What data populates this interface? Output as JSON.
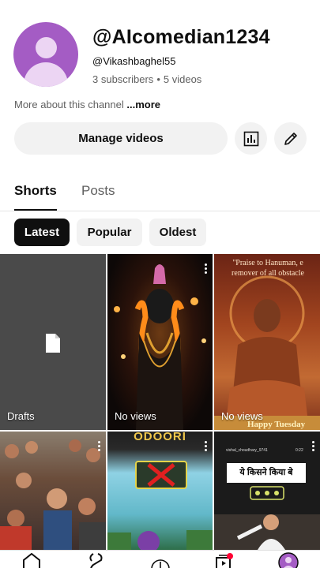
{
  "channel": {
    "name": "@AIcomedian1234",
    "handle": "@Vikashbaghel55",
    "subscribers": "3 subscribers",
    "separator": "•",
    "videos": "5 videos",
    "avatar_color": "#a45cc4"
  },
  "about": {
    "text": "More about this channel ",
    "more_label": "...more"
  },
  "actions": {
    "manage_label": "Manage videos",
    "stats_icon": "analytics-icon",
    "edit_icon": "pencil-icon"
  },
  "tabs": [
    {
      "label": "Shorts",
      "active": true
    },
    {
      "label": "Posts",
      "active": false
    }
  ],
  "filters": [
    {
      "label": "Latest",
      "active": true
    },
    {
      "label": "Popular",
      "active": false
    },
    {
      "label": "Oldest",
      "active": false
    }
  ],
  "shorts": [
    {
      "label": "Drafts",
      "icon": "document-icon"
    },
    {
      "label": "No views",
      "thumbnail_text": ""
    },
    {
      "label": "No views",
      "thumbnail_text": "\"Praise to Hanuman,  e remover of all obstacle",
      "bottom_text": "Happy Tuesday"
    },
    {
      "label": ""
    },
    {
      "label": "",
      "thumbnail_text": "ODOORI"
    },
    {
      "label": "",
      "thumbnail_user": "vishal_choudhary_9741",
      "thumbnail_time": "0:22",
      "thumbnail_text": "ये किसने किया बे"
    }
  ],
  "colors": {
    "accent": "#0f0f0f",
    "chip_bg": "#f2f2f2",
    "secondary_text": "#606060",
    "notification": "#ff0033"
  }
}
